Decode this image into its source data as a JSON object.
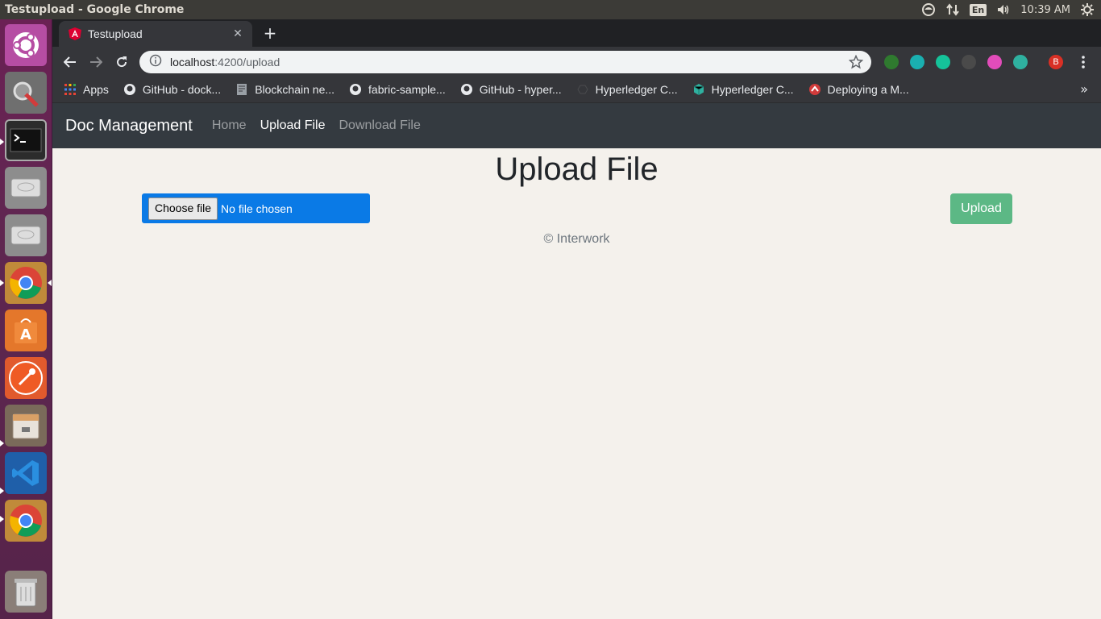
{
  "top_panel": {
    "window_title": "Testupload - Google Chrome",
    "keyboard_layout": "En",
    "clock": "10:39 AM"
  },
  "launcher": {
    "items": [
      "ubuntu-dash-icon",
      "system-settings-icon",
      "terminal-icon",
      "disk-drive-icon",
      "disk-drive-icon",
      "chrome-icon",
      "software-center-icon",
      "postman-icon",
      "file-manager-icon",
      "vscode-icon",
      "chrome-icon",
      "trash-icon"
    ]
  },
  "browser": {
    "tab_title": "Testupload",
    "url_host": "localhost",
    "url_path": ":4200/upload",
    "bookmarks": [
      "Apps",
      "GitHub - dock...",
      "Blockchain ne...",
      "fabric-sample...",
      "GitHub - hyper...",
      "Hyperledger C...",
      "Hyperledger C...",
      "Deploying a M..."
    ],
    "profile_initial": "B"
  },
  "page": {
    "brand": "Doc Management",
    "nav": {
      "home": "Home",
      "upload": "Upload File",
      "download": "Download File"
    },
    "title": "Upload File",
    "file_button": "Choose file",
    "file_status": "No file chosen",
    "upload_button": "Upload",
    "footer": "© Interwork"
  },
  "colors": {
    "navbar_bg": "#343a40",
    "file_input_bg": "#0a7ae6",
    "upload_btn_bg": "#5cb885",
    "page_bg": "#f4f1ec",
    "launcher_bg": "#5e2750"
  }
}
